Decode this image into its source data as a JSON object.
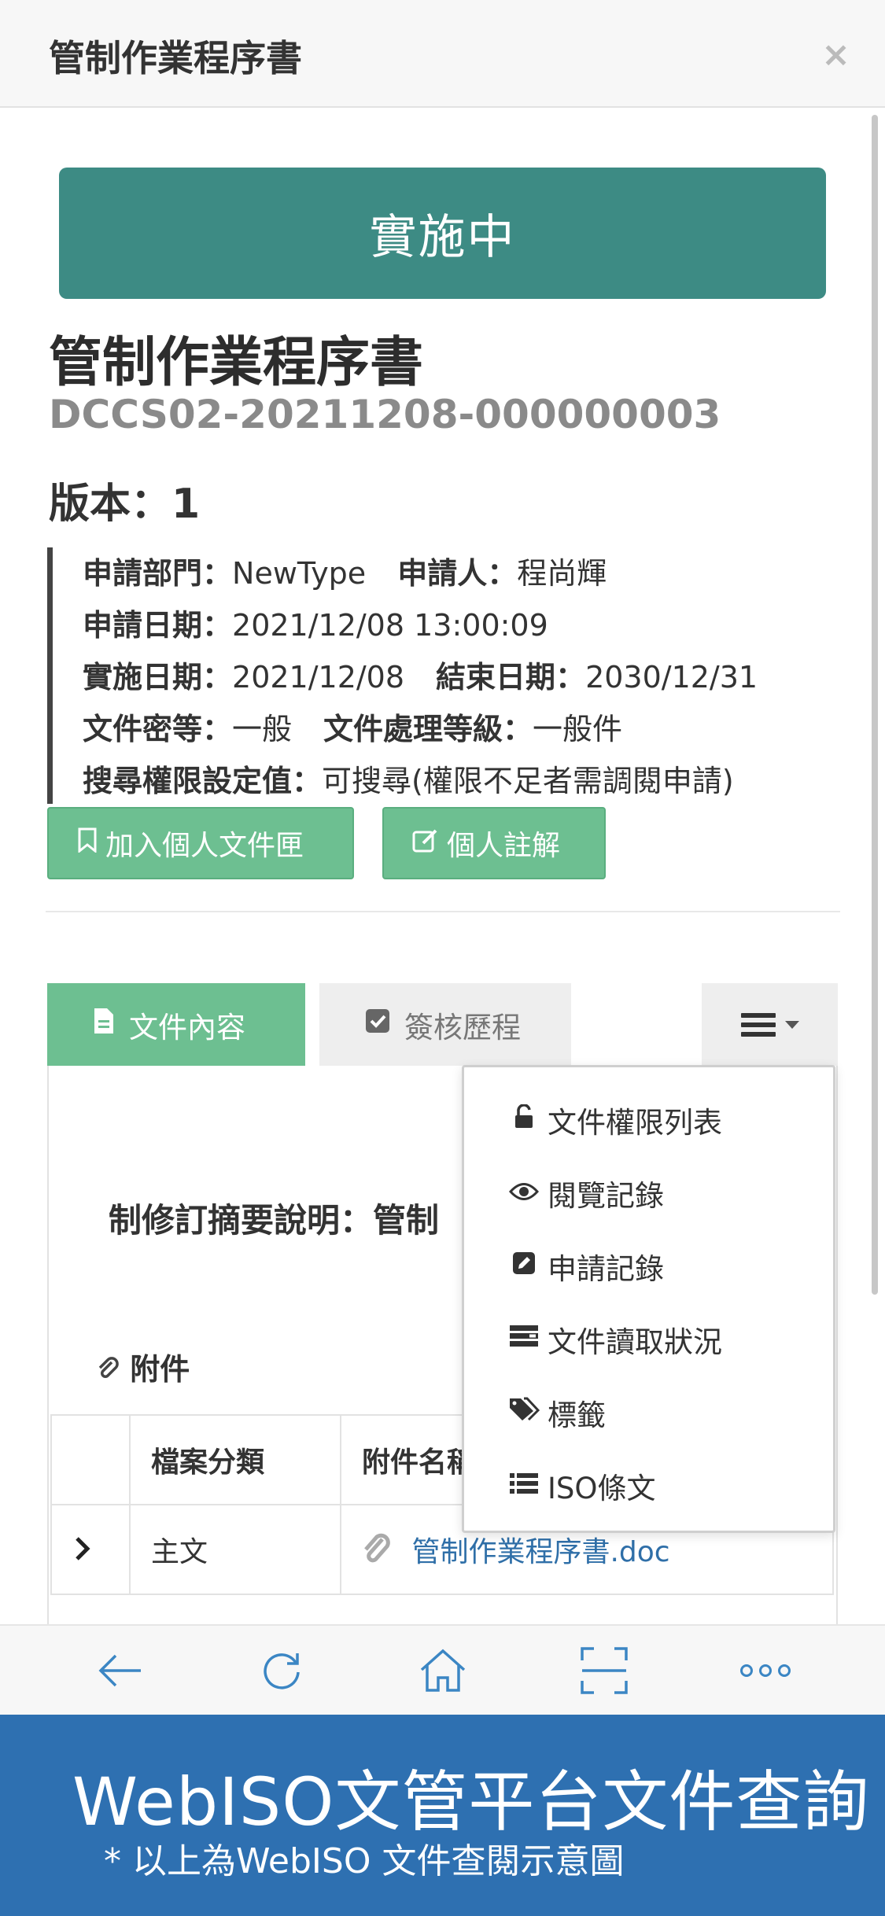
{
  "header": {
    "title": "管制作業程序書",
    "close_glyph": "×"
  },
  "status": "實施中",
  "document": {
    "title": "管制作業程序書",
    "number": "DCCS02-20211208-000000003",
    "version_label": "版本：",
    "version_value": "1"
  },
  "info": {
    "dept_label": "申請部門：",
    "dept_value": "NewType",
    "applicant_label": "申請人：",
    "applicant_value": "程尚輝",
    "apply_date_label": "申請日期：",
    "apply_date_value": "2021/12/08 13:00:09",
    "effective_label": "實施日期：",
    "effective_value": "2021/12/08",
    "end_label": "結束日期：",
    "end_value": "2030/12/31",
    "secrecy_label": "文件密等：",
    "secrecy_value": "一般",
    "handling_label": "文件處理等級：",
    "handling_value": "一般件",
    "search_label": "搜尋權限設定值：",
    "search_value": "可搜尋(權限不足者需調閱申請)"
  },
  "actions": {
    "add_folder": "加入個人文件匣",
    "annotate": "個人註解"
  },
  "tabs": {
    "content": "文件內容",
    "review": "簽核歷程"
  },
  "content": {
    "summary_label": "制修訂摘要說明：管制",
    "attachments_label": "附件"
  },
  "table": {
    "headers": [
      "",
      "檔案分類",
      "附件名稱"
    ],
    "rows": [
      {
        "category": "主文",
        "file": "管制作業程序書.doc"
      }
    ]
  },
  "menu": {
    "items": [
      {
        "label": "文件權限列表",
        "icon": "unlock-icon"
      },
      {
        "label": "閱覽記錄",
        "icon": "eye-icon"
      },
      {
        "label": "申請記錄",
        "icon": "edit-icon"
      },
      {
        "label": "文件讀取狀況",
        "icon": "tasks-icon"
      },
      {
        "label": "標籤",
        "icon": "tags-icon"
      },
      {
        "label": "ISO條文",
        "icon": "list-icon"
      }
    ]
  },
  "caption": {
    "main": "WebISO文管平台文件查詢",
    "sub": "* 以上為WebISO 文件查閱示意圖"
  },
  "colors": {
    "status": "#3d8b84",
    "accent_green": "#6dbf91",
    "link": "#2f6fa8",
    "caption_bg": "#2e70b1",
    "nav_icon": "#3b86c4"
  }
}
